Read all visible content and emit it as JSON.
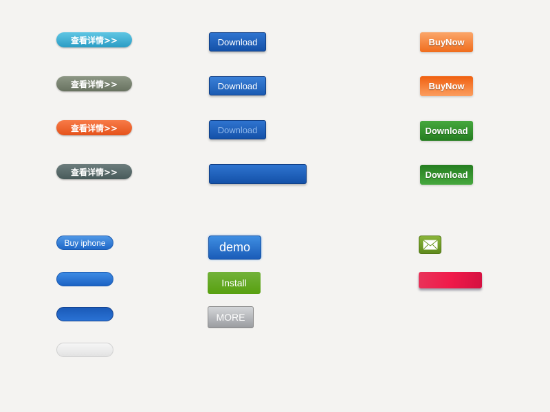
{
  "details_buttons": [
    {
      "label": "查看详情>>",
      "color": "#3fb0d4"
    },
    {
      "label": "查看详情>>",
      "color": "#7a8572"
    },
    {
      "label": "查看详情>>",
      "color": "#f0622a"
    },
    {
      "label": "查看详情>>",
      "color": "#56696a"
    }
  ],
  "download_blue": [
    "Download",
    "Download",
    "Download"
  ],
  "buynow": [
    "BuyNow",
    "BuyNow"
  ],
  "download_green": [
    "Download",
    "Download"
  ],
  "buy_iphone": "Buy iphone",
  "demo": "demo",
  "install": "Install",
  "more": "MORE",
  "icons": {
    "mail": "envelope-icon"
  }
}
